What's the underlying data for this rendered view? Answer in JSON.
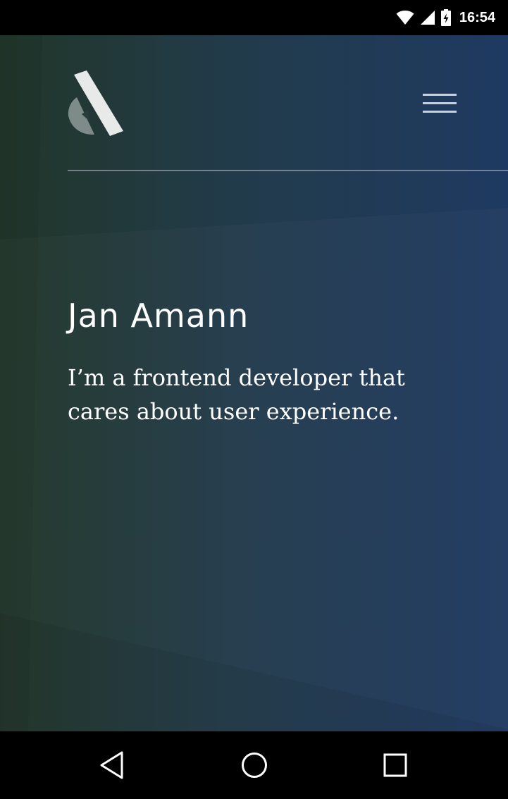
{
  "status_bar": {
    "time": "16:54",
    "icons": [
      "wifi-icon",
      "cell-signal-icon",
      "battery-charging-icon"
    ]
  },
  "header": {
    "logo": "site-logo",
    "menu_icon": "hamburger-menu-icon"
  },
  "hero": {
    "title": "Jan Amann",
    "tagline": "I’m a frontend developer that cares about user experience."
  },
  "nav_bar": {
    "icons": [
      "back-icon",
      "home-icon",
      "recent-apps-icon"
    ]
  },
  "colors": {
    "background_left": "#213629",
    "background_right": "#1f3a62",
    "text": "#ffffff",
    "rule": "#8a96a3"
  }
}
